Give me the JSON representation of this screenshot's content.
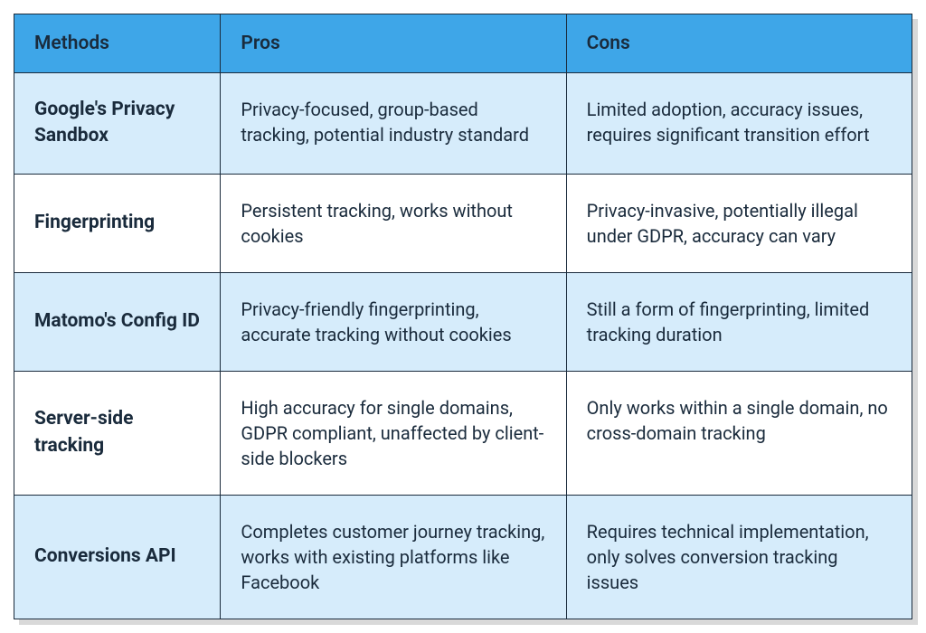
{
  "table": {
    "headers": {
      "methods": "Methods",
      "pros": "Pros",
      "cons": "Cons"
    },
    "rows": [
      {
        "method": "Google's Privacy Sandbox",
        "pros": "Privacy-focused, group-based tracking, potential industry standard",
        "cons": "Limited adoption, accuracy issues, requires significant transition effort"
      },
      {
        "method": "Fingerprinting",
        "pros": "Persistent tracking, works without cookies",
        "cons": "Privacy-invasive, potentially illegal under GDPR, accuracy can vary"
      },
      {
        "method": "Matomo's Config ID",
        "pros": "Privacy-friendly fingerprinting, accurate tracking without cookies",
        "cons": "Still a form of fingerprinting, limited tracking duration"
      },
      {
        "method": "Server-side tracking",
        "pros": "High accuracy for single domains, GDPR compliant, unaffected by client-side blockers",
        "cons": "Only works within a single domain, no cross-domain tracking"
      },
      {
        "method": "Conversions API",
        "pros": "Completes customer journey tracking, works with existing platforms like Facebook",
        "cons": "Requires technical implementation, only solves conversion tracking issues"
      }
    ]
  }
}
